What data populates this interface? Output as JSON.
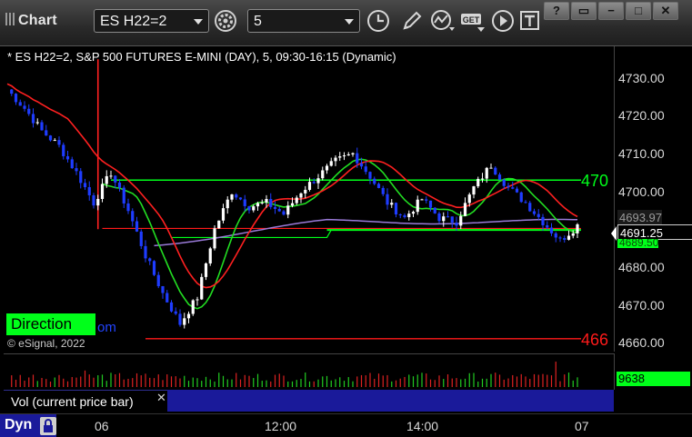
{
  "app": {
    "title": "Chart"
  },
  "toolbar": {
    "symbol": "ES H22=2",
    "interval": "5",
    "icons": [
      "gear-icon",
      "clock-icon",
      "pencil-icon",
      "study-icon",
      "get-icon",
      "play-icon",
      "text-icon"
    ],
    "get_label": "GET"
  },
  "window_buttons": [
    "?",
    "▭",
    "−",
    "□",
    "✕"
  ],
  "chart": {
    "header": "* ES H22=2, S&P 500 FUTURES E-MINI (DAY), 5, 09:30-16:15 (Dynamic)",
    "direction_label": "Direction",
    "direction_suffix": "om",
    "copyright": "© eSignal, 2022",
    "line_label_green": "470",
    "line_label_red": "466",
    "price_ticks": [
      "4730.00",
      "4720.00",
      "4710.00",
      "4700.00",
      "4690.00",
      "4680.00",
      "4670.00",
      "4660.00"
    ],
    "price_labels": {
      "upper": "4693.97",
      "last": "4691.25",
      "lower": "4689.50"
    },
    "colors": {
      "up_candle": "#ffffff",
      "down_candle": "#1e3cff",
      "green_line": "#00ff1a",
      "red_line": "#ff1a1a",
      "purple_line": "#9a7ad8",
      "red_ma": "#ff2020",
      "green_ma": "#22dd22"
    }
  },
  "volume": {
    "title": "Vol (current price bar)",
    "close": "✕",
    "value": "9638"
  },
  "time_axis": {
    "dyn": "Dyn",
    "ticks": [
      "06",
      "12:00",
      "14:00",
      "07"
    ]
  },
  "chart_data": {
    "type": "candlestick",
    "title": "* ES H22=2, S&P 500 FUTURES E-MINI (DAY), 5, 09:30-16:15 (Dynamic)",
    "ylim": [
      4658,
      4738
    ],
    "x_ticks": [
      "06",
      "12:00",
      "14:00",
      "07"
    ],
    "horizontal_lines": [
      {
        "color": "green",
        "value": 4703
      },
      {
        "color": "red",
        "value": 4661
      }
    ],
    "last_price": 4691.25
  }
}
